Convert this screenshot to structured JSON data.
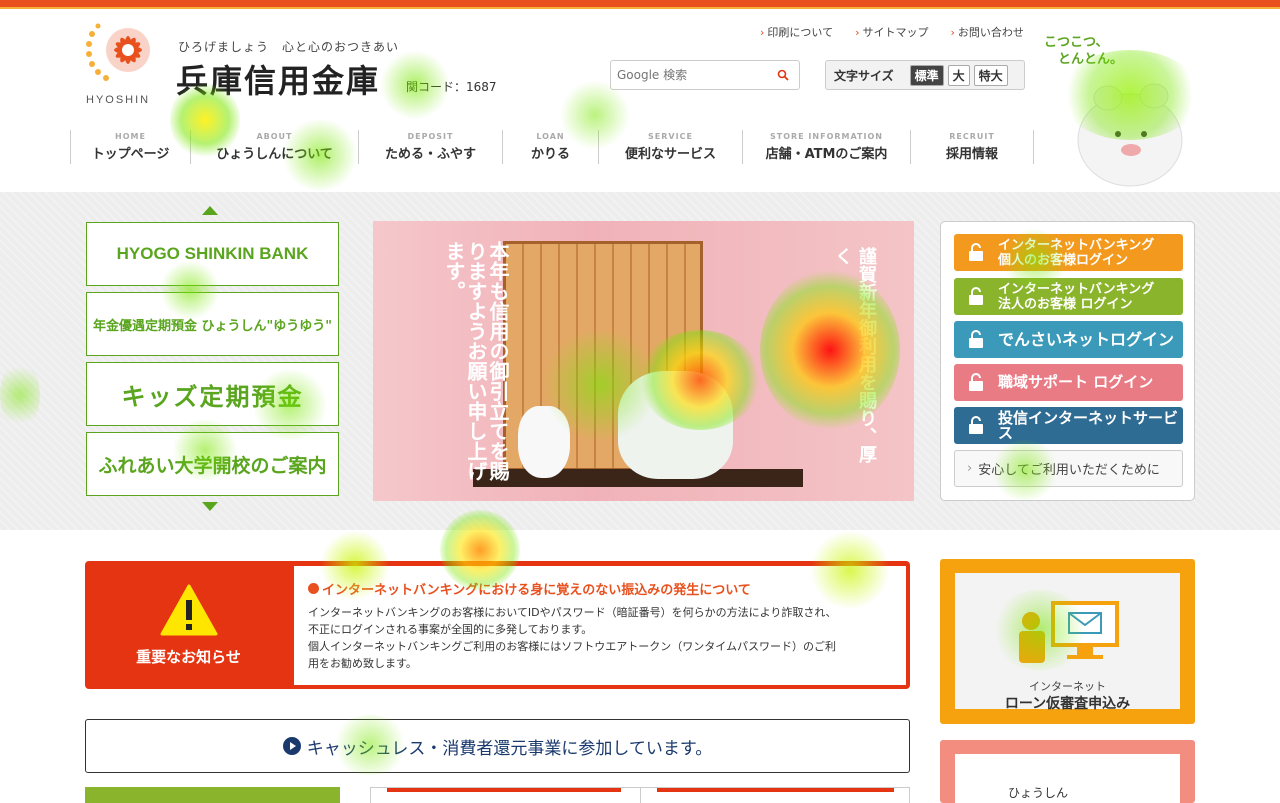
{
  "header": {
    "logo_text": "HYOSHIN",
    "tagline": "ひろげましょう　心と心のおつきあい",
    "bank_name": "兵庫信用金庫",
    "bank_code": "関コード：1687",
    "utils": [
      "印刷について",
      "サイトマップ",
      "お問い合わせ"
    ],
    "search_placeholder": "Google 検索",
    "fontsize_label": "文字サイズ",
    "fontsize_options": [
      "標準",
      "大",
      "特大"
    ],
    "mascot_text_1": "こつこつ、",
    "mascot_text_2": "とんとん。"
  },
  "gnav": [
    {
      "en": "HOME",
      "jp": "トップページ"
    },
    {
      "en": "ABOUT",
      "jp": "ひょうしんについて"
    },
    {
      "en": "DEPOSIT",
      "jp": "ためる・ふやす"
    },
    {
      "en": "LOAN",
      "jp": "かりる"
    },
    {
      "en": "SERVICE",
      "jp": "便利なサービス"
    },
    {
      "en": "STORE INFORMATION",
      "jp": "店舗・ATMのご案内"
    },
    {
      "en": "RECRUIT",
      "jp": "採用情報"
    }
  ],
  "side_banners": [
    "HYOGO SHINKIN BANK",
    "年金優遇定期預金 ひょうしん\"ゆうゆう\"",
    "キッズ定期預金",
    "ふれあい大学開校のご案内"
  ],
  "hero": {
    "text_left": "本年も信用の御引立てを賜りますようお願い申し上げます。",
    "text_right": "謹賀新年御利用を賜り、厚く"
  },
  "login": [
    {
      "label_1": "インターネットバンキング",
      "label_2": "個人のお客様ログイン"
    },
    {
      "label_1": "インターネットバンキング",
      "label_2": "法人のお客様 ログイン"
    },
    {
      "label_1": "でんさいネットログイン"
    },
    {
      "label_1": "職域サポート ログイン"
    },
    {
      "label_1": "投信インターネットサービス"
    },
    {
      "label_1": "安心してご利用いただくために"
    }
  ],
  "notice": {
    "label": "重要なお知らせ",
    "title": "インターネットバンキングにおける身に覚えのない振込みの発生について",
    "body_1": "インターネットバンキングのお客様においてIDやパスワード（暗証番号）を何らかの方法により詐取され、",
    "body_2": "不正にログインされる事案が全国的に多発しております。",
    "body_3": "個人インターネットバンキングご利用のお客様にはソフトウエアトークン（ワンタイムパスワード）のご利",
    "body_4": "用をお勧め致します。"
  },
  "cashless": "キャッシュレス・消費者還元事業に参加しています。",
  "loan_banner": {
    "small": "インターネット",
    "main": "ローン仮審査申込み"
  },
  "pink_banner": {
    "text": "ひょうしん"
  },
  "colors": {
    "brand_orange": "#e8501e",
    "brand_green": "#5aa51e"
  }
}
